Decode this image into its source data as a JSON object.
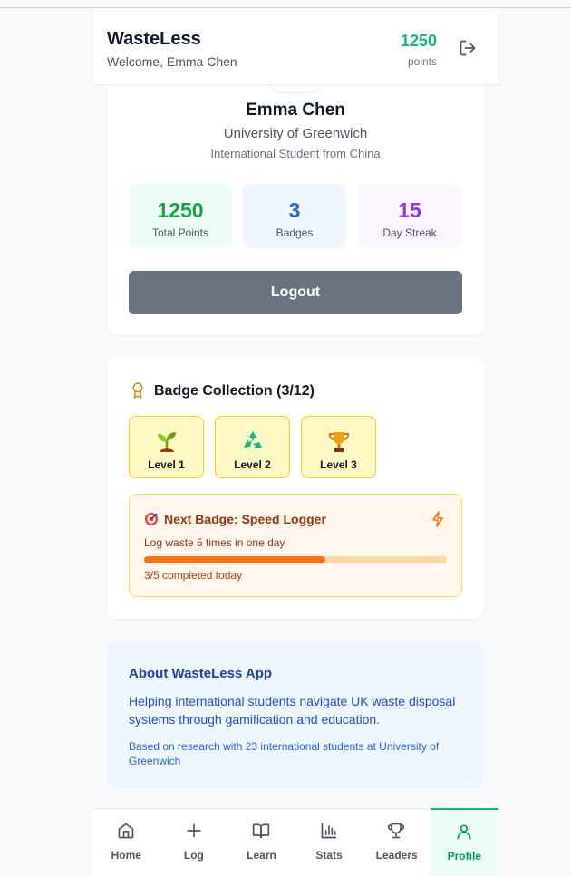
{
  "header": {
    "title": "WasteLess",
    "welcome": "Welcome, Emma Chen",
    "points_value": "1250",
    "points_label": "points",
    "logout_icon": "log-out-icon"
  },
  "profile": {
    "name": "Emma Chen",
    "university": "University of Greenwich",
    "origin": "International Student from China",
    "stats": [
      {
        "value": "1250",
        "label": "Total Points",
        "color": "#16a34a"
      },
      {
        "value": "3",
        "label": "Badges",
        "color": "#2563eb"
      },
      {
        "value": "15",
        "label": "Day Streak",
        "color": "#9333ea"
      }
    ],
    "logout_label": "Logout"
  },
  "badges": {
    "title": "Badge Collection (3/12)",
    "icon": "award-icon",
    "items": [
      {
        "emoji": "🌱",
        "label": "Level 1"
      },
      {
        "emoji": "♻️",
        "label": "Level 2"
      },
      {
        "emoji": "🏆",
        "label": "Level 3"
      }
    ],
    "next": {
      "emoji": "🎯",
      "title": "Next Badge: Speed Logger",
      "description": "Log waste 5 times in one day",
      "progress": 0.6,
      "status": "3/5 completed today",
      "accent": "#f97316"
    }
  },
  "about": {
    "title": "About WasteLess App",
    "text": "Helping international students navigate UK waste disposal systems through gamification and education.",
    "note": "Based on research with 23 international students at University of Greenwich"
  },
  "nav": {
    "items": [
      {
        "label": "Home",
        "icon": "home-icon"
      },
      {
        "label": "Log",
        "icon": "plus-icon"
      },
      {
        "label": "Learn",
        "icon": "book-icon"
      },
      {
        "label": "Stats",
        "icon": "bar-chart-icon"
      },
      {
        "label": "Leaders",
        "icon": "trophy-icon"
      },
      {
        "label": "Profile",
        "icon": "user-icon"
      }
    ],
    "active": "Profile"
  }
}
